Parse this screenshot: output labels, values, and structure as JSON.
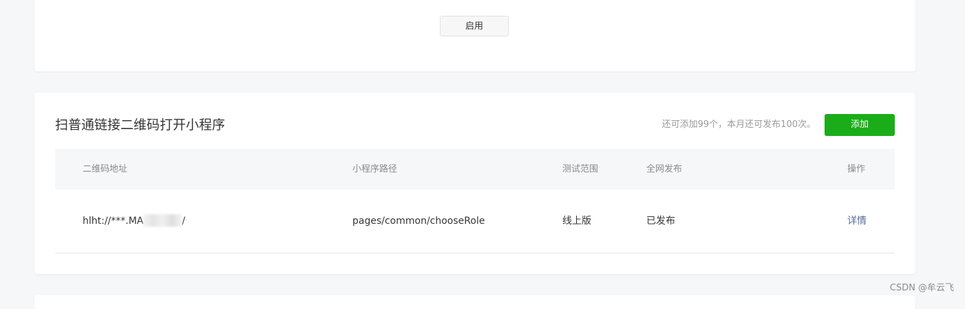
{
  "top_card": {
    "enable_label": "启用"
  },
  "section": {
    "title": "扫普通链接二维码打开小程序",
    "quota": "还可添加99个，本月还可发布100次。",
    "add_label": "添加"
  },
  "table": {
    "headers": [
      "二维码地址",
      "小程序路径",
      "测试范围",
      "全网发布",
      "操作"
    ],
    "rows": [
      {
        "qr_prefix": "hlht://***.MA",
        "qr_suffix": "/",
        "path": "pages/common/chooseRole",
        "test_scope": "线上版",
        "publish_status": "已发布",
        "action": "详情"
      }
    ]
  },
  "colors": {
    "primary_green": "#1aad19",
    "link_blue": "#576b95",
    "page_background": "#f6f7f9"
  },
  "watermark": "CSDN @牟云飞"
}
